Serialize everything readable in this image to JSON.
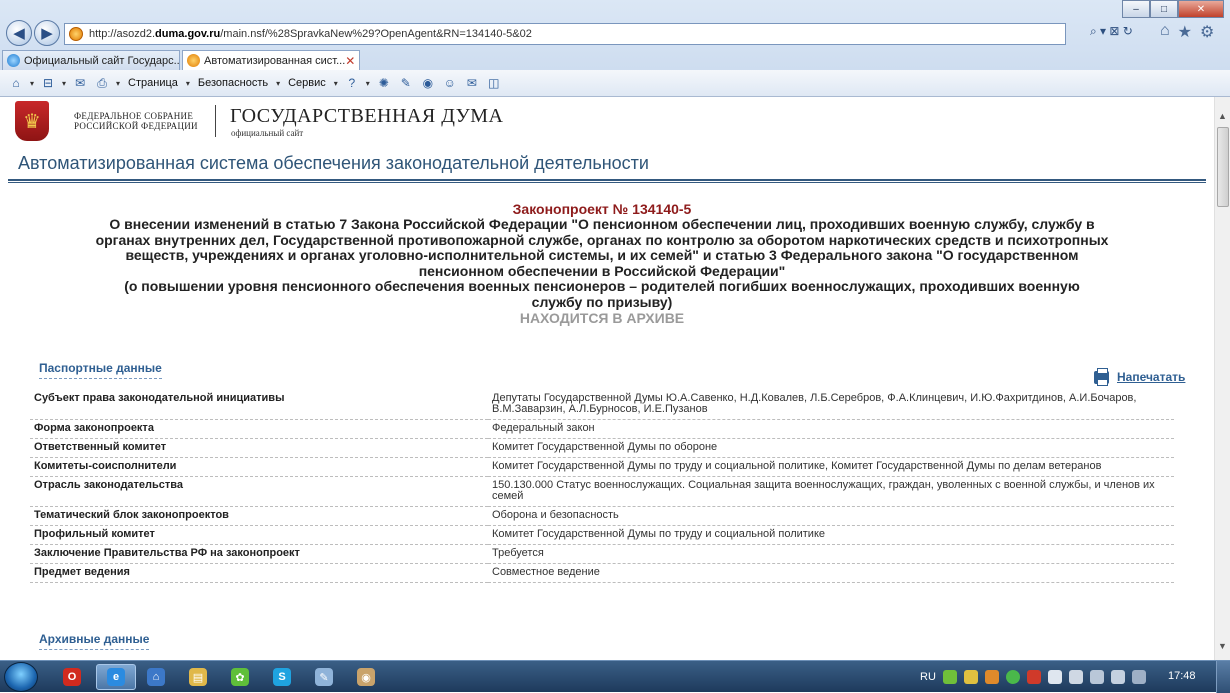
{
  "browser": {
    "url_prefix": "http://asozd2.",
    "url_domain": "duma.gov.ru",
    "url_rest": "/main.nsf/%28SpravkaNew%29?OpenAgent&RN=134140-5&02",
    "window_controls": {
      "minimize": "–",
      "maximize": "□",
      "close": "✕"
    },
    "nav": {
      "back": "◀",
      "forward": "▶"
    },
    "address_tools": "⌕ ▾ ⊠ ↻",
    "right_icons": {
      "home": "⌂",
      "favorites": "★",
      "tools": "⚙"
    },
    "tabs": [
      {
        "label": "Официальный сайт Государс..."
      },
      {
        "label": "Автоматизированная сист...",
        "close": "✕"
      }
    ],
    "command_bar": {
      "home_icon": "⌂",
      "feeds_icon": "⊟",
      "mail_icon": "✉",
      "print_icon": "⎙",
      "page": "Страница",
      "safety": "Безопасность",
      "tools": "Сервис",
      "help_icon": "?",
      "extra_icons": [
        "✺",
        "✎",
        "◉",
        "☺",
        "✉",
        "◫"
      ],
      "caret": "▾"
    }
  },
  "site": {
    "emblem": "♛",
    "org_line1": "Федеральное собрание",
    "org_line2": "Российской Федерации",
    "title": "ГОСУДАРСТВЕННАЯ ДУМА",
    "subtitle": "официальный сайт",
    "system_title": "Автоматизированная система обеспечения законодательной деятельности"
  },
  "bill": {
    "number": "Законопроект № 134140-5",
    "title": "О внесении изменений в статью 7 Закона Российской Федерации \"О пенсионном обеспечении лиц, проходивших военную службу, службу в органах внутренних дел, Государственной противопожарной службе, органах по контролю за оборотом наркотических средств и психотропных веществ, учреждениях и органах уголовно-исполнительной системы, и их семей\" и статью 3 Федерального закона \"О государственном пенсионном обеспечении в Российской Федерации\"",
    "subtitle": "(о повышении уровня пенсионного обеспечения военных пенсионеров – родителей погибших военнослужащих, проходивших военную службу по призыву)",
    "status": "НАХОДИТСЯ В АРХИВЕ"
  },
  "passport": {
    "heading": "Паспортные данные",
    "print_label": "Напечатать",
    "rows": [
      {
        "key": "Субъект права законодательной инициативы",
        "value": "Депутаты Государственной Думы Ю.А.Савенко, Н.Д.Ковалев, Л.Б.Серебров, Ф.А.Клинцевич, И.Ю.Фахритдинов, А.И.Бочаров, В.М.Заварзин, А.Л.Бурносов, И.Е.Пузанов"
      },
      {
        "key": "Форма законопроекта",
        "value": "Федеральный закон"
      },
      {
        "key": "Ответственный комитет",
        "value": "Комитет Государственной Думы по обороне"
      },
      {
        "key": "Комитеты-соисполнители",
        "value": "Комитет Государственной Думы по труду и социальной политике, Комитет Государственной Думы по делам ветеранов"
      },
      {
        "key": "Отрасль законодательства",
        "value": "150.130.000 Статус военнослужащих. Социальная защита военнослужащих, граждан, уволенных с военной службы, и членов их семей"
      },
      {
        "key": "Тематический блок законопроектов",
        "value": "Оборона и безопасность"
      },
      {
        "key": "Профильный комитет",
        "value": "Комитет Государственной Думы по труду и социальной политике"
      },
      {
        "key": "Заключение Правительства РФ на законопроект",
        "value": "Требуется"
      },
      {
        "key": "Предмет ведения",
        "value": "Совместное ведение"
      }
    ]
  },
  "archive": {
    "heading": "Архивные данные"
  },
  "scrollbar": {
    "up": "▲",
    "down": "▼"
  },
  "taskbar": {
    "apps": [
      {
        "name": "opera",
        "glyph": "O",
        "color": "#d12a1f"
      },
      {
        "name": "ie",
        "glyph": "e",
        "color": "#2b8be0"
      },
      {
        "name": "network",
        "glyph": "⌂",
        "color": "#3c78c8"
      },
      {
        "name": "explorer",
        "glyph": "▤",
        "color": "#e0b84a"
      },
      {
        "name": "icq",
        "glyph": "✿",
        "color": "#5fbf3a"
      },
      {
        "name": "skype",
        "glyph": "S",
        "color": "#1fa3e0"
      },
      {
        "name": "notepad",
        "glyph": "✎",
        "color": "#8fb3d9"
      },
      {
        "name": "paint",
        "glyph": "◉",
        "color": "#c9a36b"
      }
    ],
    "language": "RU",
    "clock": "17:48"
  }
}
